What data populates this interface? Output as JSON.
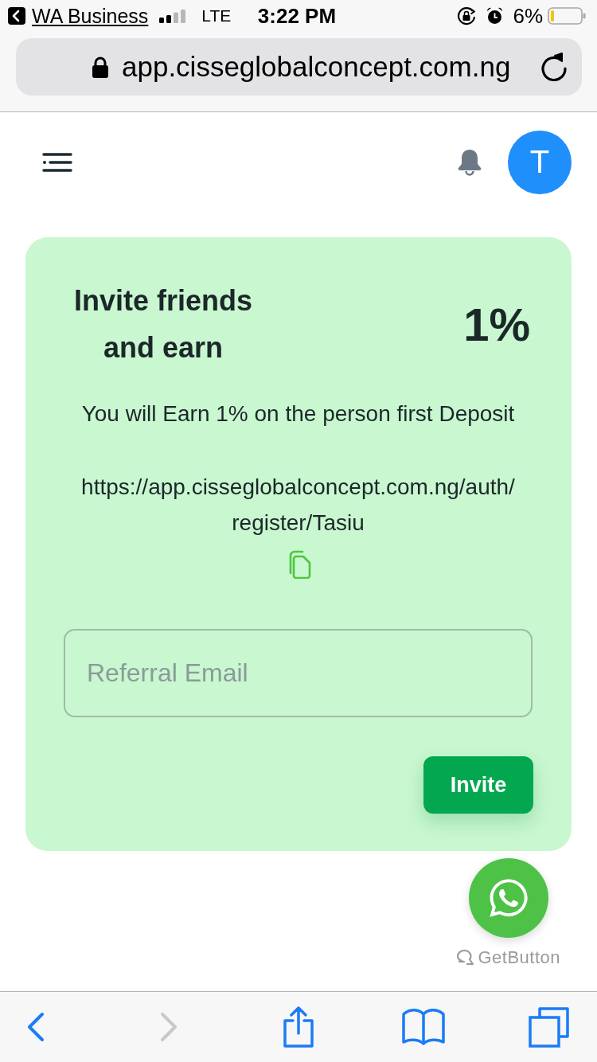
{
  "status_bar": {
    "back_app": "WA Business",
    "network": "LTE",
    "time": "3:22 PM",
    "battery": "6%"
  },
  "address_bar": {
    "url": "app.cisseglobalconcept.com.ng"
  },
  "header": {
    "avatar_initial": "T"
  },
  "invite_card": {
    "title": "Invite friends and earn",
    "rate": "1%",
    "description": "You will Earn 1% on the person first Deposit",
    "referral_link": "https://app.cisseglobalconcept.com.ng/auth/register/Tasiu",
    "email_field": {
      "placeholder": "Referral Email"
    },
    "button": "Invite"
  },
  "chat_widget": {
    "credit": "GetButton"
  },
  "toolbar": {
    "items": [
      {
        "kind": "back",
        "disabled": false
      },
      {
        "kind": "forward",
        "disabled": true
      },
      {
        "kind": "share",
        "disabled": false
      },
      {
        "kind": "bookmarks",
        "disabled": false
      },
      {
        "kind": "tabs",
        "disabled": false
      }
    ]
  }
}
